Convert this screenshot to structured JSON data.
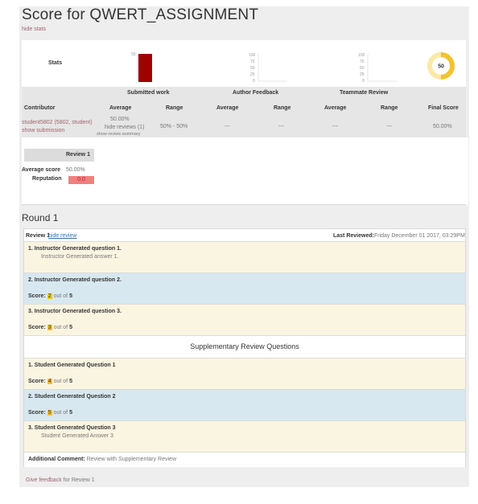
{
  "header": {
    "title": "Score for QWERT_ASSIGNMENT",
    "hide_stats_link": "hide stats"
  },
  "stats": {
    "label": "Stats",
    "submitted_chart": {
      "type": "bar",
      "value": 50,
      "ylim": [
        0,
        100
      ],
      "tick_label": "50",
      "color": "#a00000"
    },
    "author_chart": {
      "type": "bar",
      "ticks": [
        "100",
        "75",
        "50",
        "25",
        "0"
      ]
    },
    "teammate_chart": {
      "type": "bar",
      "ticks": [
        "100",
        "75",
        "50",
        "25",
        "0"
      ]
    },
    "donut": {
      "value": 50,
      "label": "50",
      "color": "#f1c232",
      "track_color": "#fbe9a6"
    }
  },
  "chart_data": [
    {
      "type": "bar",
      "categories": [
        ""
      ],
      "values": [
        50
      ],
      "ylim": [
        0,
        100
      ],
      "title": "",
      "xlabel": "",
      "ylabel": ""
    },
    {
      "type": "bar",
      "categories": [],
      "values": [],
      "ylim": [
        0,
        100
      ],
      "title": "",
      "xlabel": "",
      "ylabel": ""
    },
    {
      "type": "bar",
      "categories": [],
      "values": [],
      "ylim": [
        0,
        100
      ],
      "title": "",
      "xlabel": "",
      "ylabel": ""
    }
  ],
  "table": {
    "groups": [
      "Submitted work",
      "Author Feedback",
      "Teammate Review"
    ],
    "columns": [
      "Contributor",
      "Average",
      "Range",
      "Average",
      "Range",
      "Average",
      "Range",
      "Final Score"
    ],
    "row": {
      "contributor": "student5802 (5802, student)",
      "show_submission": "show submission",
      "submitted_avg": "50.00%",
      "hide_reviews": "hide reviews (1)",
      "show_review_summary": "show review summary",
      "submitted_range": "50% - 50%",
      "author_avg": "---",
      "author_range": "---",
      "teammate_avg": "---",
      "teammate_range": "---",
      "final_score": "50.00%"
    }
  },
  "reputation": {
    "header": "Review 1",
    "average_label": "Average score",
    "average_value": "50.00%",
    "reputation_label": "Reputation",
    "reputation_value": "0.0"
  },
  "round": {
    "title": "Round 1",
    "review_label": "Review 1",
    "hide_review": "hide review",
    "last_reviewed_label": "Last Reviewed:",
    "last_reviewed_value": "Friday December 01 2017, 03:29PM",
    "questions": [
      {
        "q": "1. Instructor Generated question 1.",
        "answer": "Instructor Generated answer 1."
      },
      {
        "q": "2. Instructor Generated question 2.",
        "score_label": "Score:",
        "score": "2",
        "out_of": "out of",
        "max": "5"
      },
      {
        "q": "3. Instructor Generated question 3.",
        "score_label": "Score:",
        "score": "3",
        "out_of": "out of",
        "max": "5"
      }
    ],
    "supplementary_title": "Supplementary Review Questions",
    "supp_questions": [
      {
        "q": "1. Student Generated Question 1",
        "score_label": "Score:",
        "score": "4",
        "out_of": "out of",
        "max": "5"
      },
      {
        "q": "2. Student Generated Question 2",
        "score_label": "Score:",
        "score": "5",
        "out_of": "out of",
        "max": "5"
      },
      {
        "q": "3. Student Generated Question 3",
        "answer": "Student Generated Answer 3"
      }
    ],
    "additional_comment_label": "Additional Comment:",
    "additional_comment_value": "Review with Supplementary Review"
  },
  "footer": {
    "give_feedback": "Give feedback",
    "for_review": "for Review 1"
  }
}
